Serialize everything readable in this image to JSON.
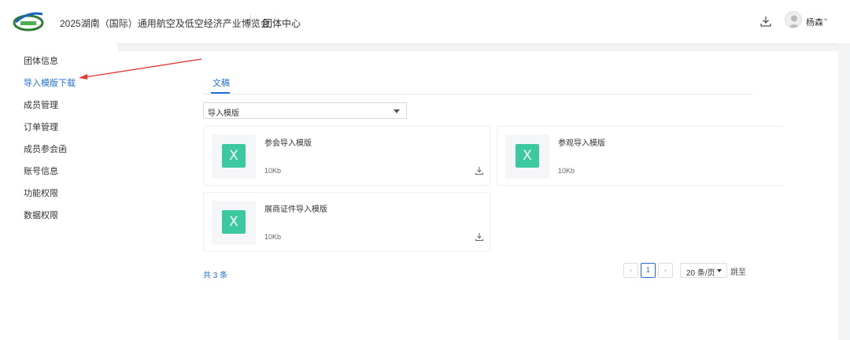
{
  "header": {
    "site_title": "2025湖南（国际）通用航空及低空经济产业博览会",
    "group_center": "团体中心",
    "user_name": "杨森"
  },
  "sidebar": {
    "items": [
      {
        "label": "团体信息",
        "active": false
      },
      {
        "label": "导入模版下载",
        "active": true
      },
      {
        "label": "成员管理",
        "active": false
      },
      {
        "label": "订单管理",
        "active": false
      },
      {
        "label": "成员参会函",
        "active": false
      },
      {
        "label": "账号信息",
        "active": false
      },
      {
        "label": "功能权限",
        "active": false
      },
      {
        "label": "数据权限",
        "active": false
      }
    ]
  },
  "main": {
    "tab_label": "文稿",
    "select_value": "导入模版",
    "cards": [
      {
        "name": "参会导入模版",
        "size": "10Kb",
        "icon_letter": "X"
      },
      {
        "name": "参观导入模版",
        "size": "10Kb",
        "icon_letter": "X"
      },
      {
        "name": "展商证件导入模版",
        "size": "10Kb",
        "icon_letter": "X"
      }
    ],
    "total_text": "共 3 条"
  },
  "pagination": {
    "prev": "‹",
    "current_page": "1",
    "next": "›",
    "page_size": "20 条/页",
    "jump_label": "跳至"
  },
  "colors": {
    "accent": "#1e6fd9",
    "excel_icon": "#3dc9a0",
    "annotation_arrow": "#e53935"
  },
  "icons": {
    "logo": "expo-logo",
    "download": "download-icon",
    "avatar": "user-avatar-icon",
    "excel": "excel-file-icon"
  }
}
